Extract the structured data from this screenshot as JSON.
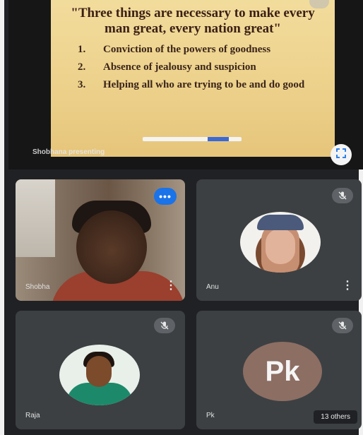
{
  "presentation": {
    "slide_title": "\"Three things are necessary to make every man great, every nation great\"",
    "items": [
      {
        "num": "1.",
        "text": "Conviction of the powers of goodness"
      },
      {
        "num": "2.",
        "text": "Absence of jealousy and suspicion"
      },
      {
        "num": "3.",
        "text": "Helping all who are trying to be and do good"
      }
    ],
    "presenter_label": "Shobhana presenting"
  },
  "participants": [
    {
      "name": "Shobha",
      "type": "video",
      "state": "speaking"
    },
    {
      "name": "Anu",
      "type": "photo",
      "state": "muted"
    },
    {
      "name": "Raja",
      "type": "photo",
      "state": "muted"
    },
    {
      "name": "Pk",
      "type": "initials",
      "initials": "Pk",
      "state": "muted",
      "chip": "13 others"
    }
  ],
  "icons": {
    "fullscreen": "fullscreen-icon",
    "mic_off": "mic-off-icon",
    "speaking": "audio-level-icon",
    "more": "more-vert-icon"
  },
  "colors": {
    "tile_bg": "#3c4043",
    "accent": "#1a73e8",
    "initials_bg": "#8d6e63"
  }
}
